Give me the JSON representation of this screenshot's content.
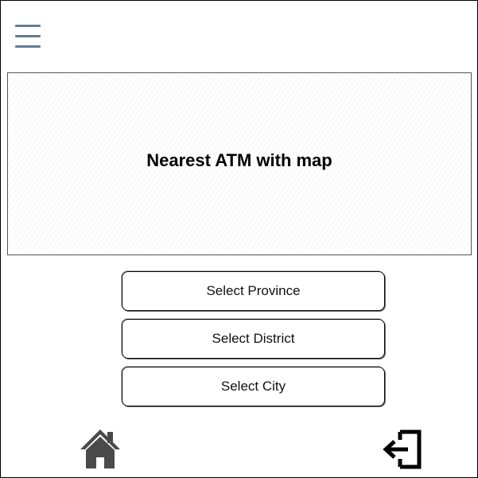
{
  "header": {
    "menu_icon": "hamburger-menu-icon",
    "menu_color": "#647C94"
  },
  "map": {
    "title": "Nearest ATM with map"
  },
  "selectors": {
    "province_label": "Select Province",
    "district_label": "Select District",
    "city_label": "Select City"
  },
  "footer": {
    "home_icon": "home-icon",
    "home_color": "#4A4A4A",
    "logout_icon": "logout-icon",
    "logout_color": "#000000"
  }
}
